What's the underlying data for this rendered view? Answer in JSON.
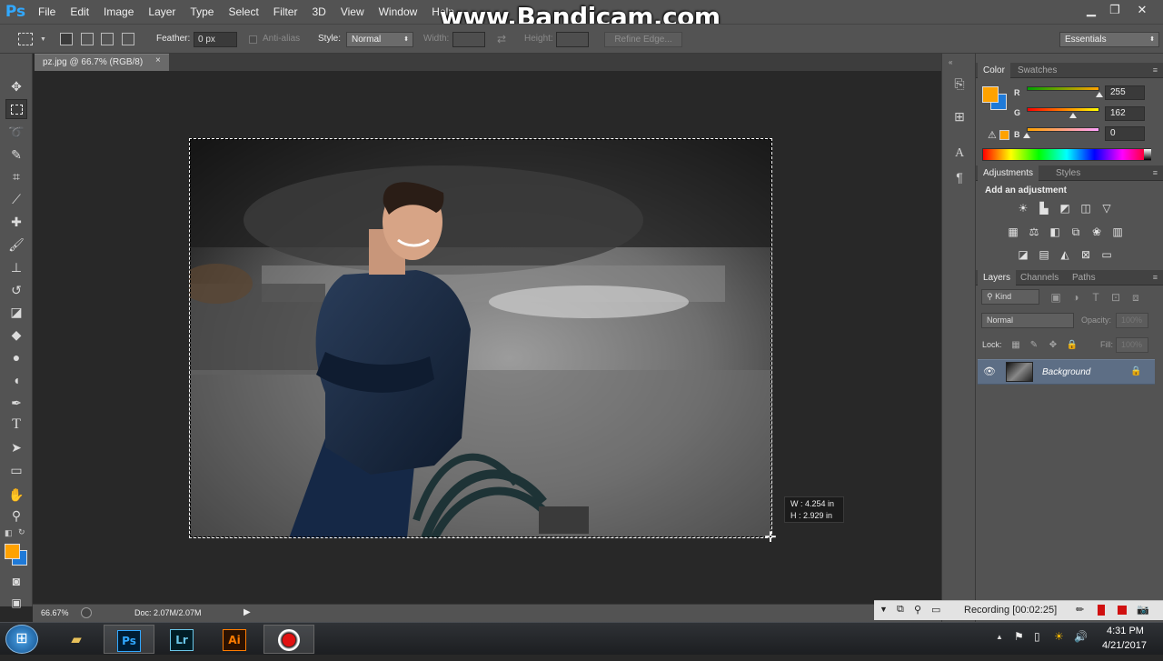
{
  "app": {
    "logo": "Ps",
    "watermark": "www.Bandicam.com"
  },
  "menu": [
    "File",
    "Edit",
    "Image",
    "Layer",
    "Type",
    "Select",
    "Filter",
    "3D",
    "View",
    "Window",
    "Help"
  ],
  "window_controls": {
    "minimize": "▁",
    "restore": "❐",
    "close": "✕"
  },
  "options": {
    "feather_label": "Feather:",
    "feather_value": "0 px",
    "antialias_label": "Anti-alias",
    "style_label": "Style:",
    "style_value": "Normal",
    "width_label": "Width:",
    "height_label": "Height:",
    "refine_edge": "Refine Edge...",
    "workspace": "Essentials"
  },
  "document": {
    "tab_title": "pz.jpg @ 66.7% (RGB/8)",
    "close": "×"
  },
  "selection_readout": {
    "w": "W :  4.254 in",
    "h": "H :  2.929 in"
  },
  "status": {
    "zoom": "66.67%",
    "doc": "Doc: 2.07M/2.07M"
  },
  "color_panel": {
    "tabs": [
      "Color",
      "Swatches"
    ],
    "r_label": "R",
    "g_label": "G",
    "b_label": "B",
    "r_value": "255",
    "g_value": "162",
    "b_value": "0",
    "r_level": 1.0,
    "g_level": 0.635,
    "b_level": 0.0,
    "foreground": "#ffa200",
    "background": "#1f7ad8"
  },
  "adjustments_panel": {
    "tabs": [
      "Adjustments",
      "Styles"
    ],
    "heading": "Add an adjustment"
  },
  "layers_panel": {
    "tabs": [
      "Layers",
      "Channels",
      "Paths"
    ],
    "kind": "Kind",
    "blend_mode": "Normal",
    "opacity_label": "Opacity:",
    "opacity_value": "100%",
    "lock_label": "Lock:",
    "fill_label": "Fill:",
    "fill_value": "100%",
    "layers": [
      {
        "name": "Background",
        "visible": true,
        "locked": true
      }
    ]
  },
  "bandicam": {
    "recording": "Recording [00:02:25]"
  },
  "taskbar": {
    "apps": [
      "Ps",
      "Lr",
      "Ai"
    ],
    "time": "4:31 PM",
    "date": "4/21/2017"
  }
}
